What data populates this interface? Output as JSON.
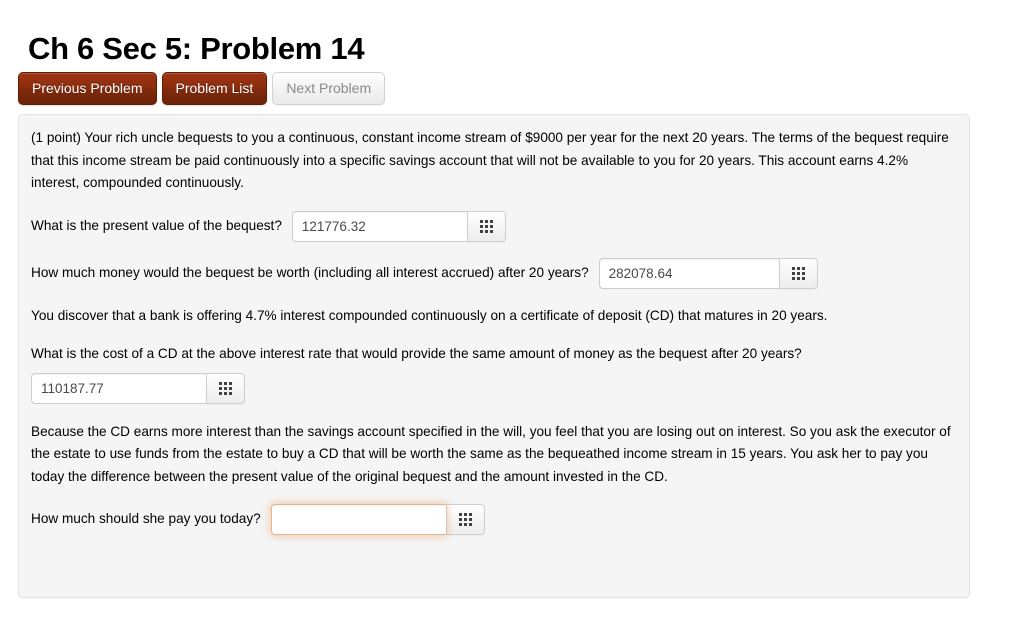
{
  "page": {
    "title": "Ch 6 Sec 5: Problem 14"
  },
  "nav": {
    "previous_label": "Previous Problem",
    "problem_list_label": "Problem List",
    "next_label": "Next Problem",
    "primary_color": "#8d2e0f",
    "disabled_text_color": "#8a8a8a"
  },
  "problem": {
    "intro": "(1 point) Your rich uncle bequests to you a continuous, constant income stream of $9000 per year for the next 20 years. The terms of the bequest require that this income stream be paid continuously into a specific savings account that will not be available to you for 20 years. This account earns 4.2% interest, compounded continuously.",
    "middle_note": "You discover that a bank is offering 4.7% interest compounded continuously on a certificate of deposit (CD) that matures in 20 years.",
    "closing_note": "Because the CD earns more interest than the savings account specified in the will, you feel that you are losing out on interest. So you ask the executor of the estate to use funds from the estate to buy a CD that will be worth the same as the bequeathed income stream in 15 years. You ask her to pay you today the difference between the present value of the original bequest and the amount invested in the CD.",
    "keypad_icon": "keypad-grid-icon",
    "questions": [
      {
        "label": "What is the present value of the bequest?",
        "value": "121776.32",
        "placeholder": "",
        "focused": false,
        "layout": "inline"
      },
      {
        "label": "How much money would the bequest be worth (including all interest accrued) after 20 years?",
        "value": "282078.64",
        "placeholder": "",
        "focused": false,
        "layout": "inline"
      },
      {
        "label": "What is the cost of a CD at the above interest rate that would provide the same amount of money as the bequest after 20 years?",
        "value": "110187.77",
        "placeholder": "",
        "focused": false,
        "layout": "stacked"
      },
      {
        "label": "How much should she pay you today?",
        "value": "",
        "placeholder": "",
        "focused": true,
        "layout": "inline"
      }
    ]
  }
}
